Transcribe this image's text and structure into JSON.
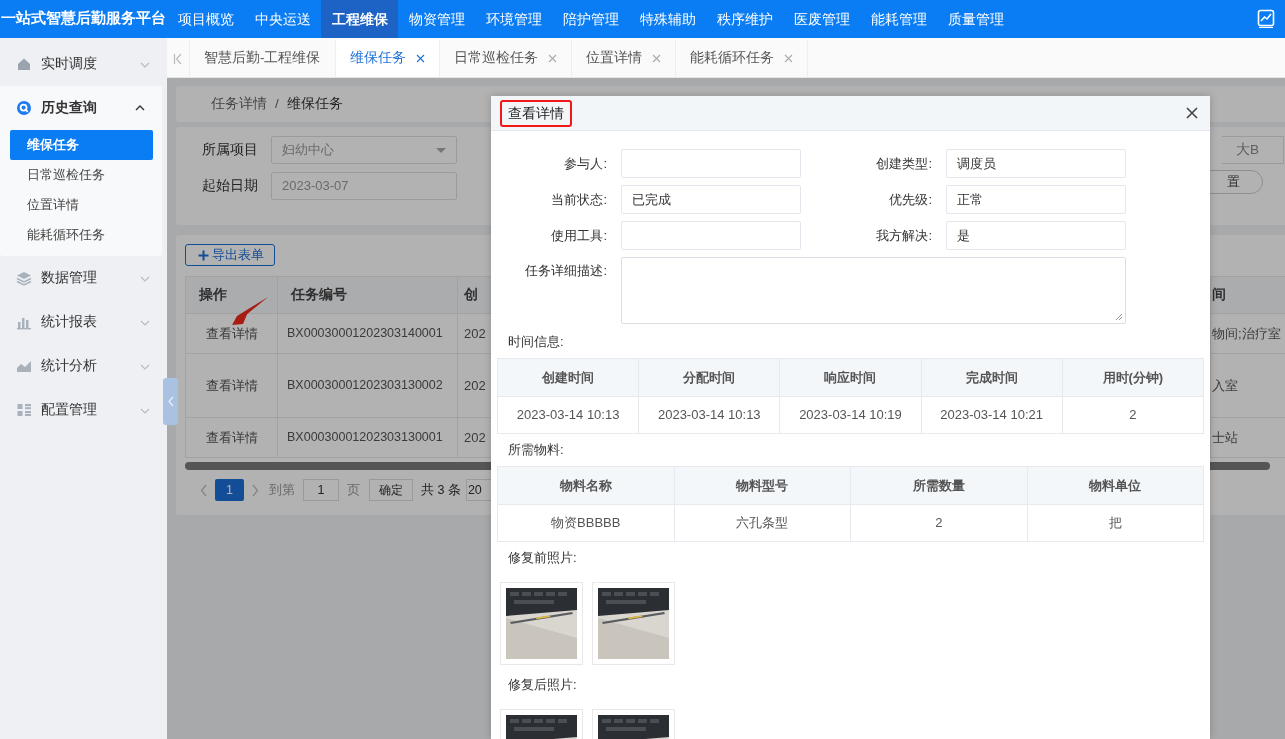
{
  "app": {
    "title": "一站式智慧后勤服务平台"
  },
  "top_nav": [
    {
      "label": "项目概览",
      "selected": false
    },
    {
      "label": "中央运送",
      "selected": false
    },
    {
      "label": "工程维保",
      "selected": true
    },
    {
      "label": "物资管理",
      "selected": false
    },
    {
      "label": "环境管理",
      "selected": false
    },
    {
      "label": "陪护管理",
      "selected": false
    },
    {
      "label": "特殊辅助",
      "selected": false
    },
    {
      "label": "秩序维护",
      "selected": false
    },
    {
      "label": "医废管理",
      "selected": false
    },
    {
      "label": "能耗管理",
      "selected": false
    },
    {
      "label": "质量管理",
      "selected": false
    }
  ],
  "sidebar": {
    "items": [
      {
        "label": "实时调度",
        "kind": "home",
        "expanded": false
      },
      {
        "label": "历史查询",
        "kind": "search",
        "expanded": true,
        "children": [
          {
            "label": "维保任务",
            "selected": true
          },
          {
            "label": "日常巡检任务",
            "selected": false
          },
          {
            "label": "位置详情",
            "selected": false
          },
          {
            "label": "能耗循环任务",
            "selected": false
          }
        ]
      },
      {
        "label": "数据管理",
        "kind": "layers",
        "expanded": false
      },
      {
        "label": "统计报表",
        "kind": "bars",
        "expanded": false
      },
      {
        "label": "统计分析",
        "kind": "area",
        "expanded": false
      },
      {
        "label": "配置管理",
        "kind": "grid",
        "expanded": false
      }
    ]
  },
  "tabs": [
    {
      "label": "智慧后勤-工程维保",
      "selected": false,
      "closable": false
    },
    {
      "label": "维保任务",
      "selected": true,
      "closable": true
    },
    {
      "label": "日常巡检任务",
      "selected": false,
      "closable": true
    },
    {
      "label": "位置详情",
      "selected": false,
      "closable": true
    },
    {
      "label": "能耗循环任务",
      "selected": false,
      "closable": true
    }
  ],
  "breadcrumb": {
    "items": [
      "任务详情",
      "维保任务"
    ],
    "separator": "/"
  },
  "filters": [
    {
      "label": "所属项目",
      "value": "妇幼中心",
      "kind": "select"
    },
    {
      "label": "起始日期",
      "value": "2023-03-07",
      "kind": "date"
    }
  ],
  "filter_right": {
    "value": "大B",
    "button": "置"
  },
  "export_button": "导出表单",
  "table": {
    "columns": [
      "操作",
      "任务编号",
      "创",
      "间"
    ],
    "rows": [
      {
        "action": "查看详情",
        "task_no": "BX00030001202303140001",
        "column_3": "202",
        "column_4": "物间;治疗室"
      },
      {
        "action": "查看详情",
        "task_no": "BX00030001202303130002",
        "column_3": "202",
        "column_4": "入室"
      },
      {
        "action": "查看详情",
        "task_no": "BX00030001202303130001",
        "column_3": "202",
        "column_4": "士站"
      }
    ]
  },
  "pagination": {
    "page": "1",
    "goto_label": "到第",
    "goto_value": "1",
    "page_unit": "页",
    "confirm": "确定",
    "total": "共 3 条",
    "page_size": "20"
  },
  "modal": {
    "title": "查看详情",
    "title_highlighted": true,
    "fields": [
      {
        "label": "参与人:"
      },
      {
        "label": "创建类型:",
        "value": "调度员"
      },
      {
        "label": "当前状态:",
        "value": "已完成"
      },
      {
        "label": "优先级:",
        "value": "正常"
      },
      {
        "label": "使用工具:"
      },
      {
        "label": "我方解决:",
        "value": "是"
      },
      {
        "label": "任务详细描述:",
        "kind": "textarea"
      }
    ],
    "time_info": {
      "label": "时间信息:",
      "columns": [
        "创建时间",
        "分配时间",
        "响应时间",
        "完成时间",
        "用时(分钟)"
      ],
      "rows": [
        [
          "2023-03-14 10:13",
          "2023-03-14 10:13",
          "2023-03-14 10:19",
          "2023-03-14 10:21",
          "2"
        ]
      ]
    },
    "materials": {
      "label": "所需物料:",
      "columns": [
        "物料名称",
        "物料型号",
        "所需数量",
        "物料单位"
      ],
      "rows": [
        [
          "物资BBBBB",
          "六孔条型",
          "2",
          "把"
        ]
      ]
    },
    "photos_before": {
      "label": "修复前照片:"
    },
    "photos_after": {
      "label": "修复后照片:"
    }
  }
}
